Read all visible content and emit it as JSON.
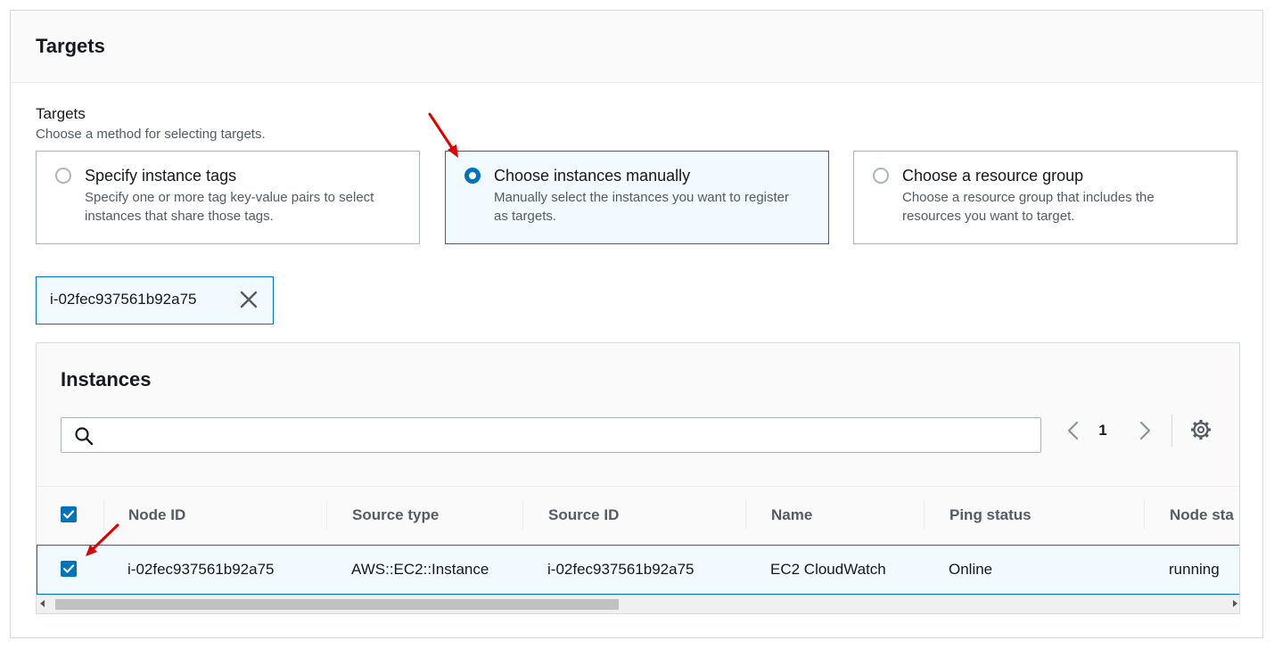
{
  "panel": {
    "title": "Targets"
  },
  "targets_field": {
    "label": "Targets",
    "description": "Choose a method for selecting targets.",
    "options": [
      {
        "title": "Specify instance tags",
        "description": "Specify one or more tag key-value pairs to select instances that share those tags.",
        "selected": false
      },
      {
        "title": "Choose instances manually",
        "description": "Manually select the instances you want to register as targets.",
        "selected": true
      },
      {
        "title": "Choose a resource group",
        "description": "Choose a resource group that includes the resources you want to target.",
        "selected": false
      }
    ]
  },
  "token": {
    "label": "i-02fec937561b92a75",
    "icon": "close-icon"
  },
  "instances": {
    "title": "Instances",
    "search": {
      "value": "",
      "placeholder": ""
    },
    "pagination": {
      "current_page": "1"
    },
    "columns": [
      "Node ID",
      "Source type",
      "Source ID",
      "Name",
      "Ping status",
      "Node sta"
    ],
    "rows": [
      {
        "selected": true,
        "node_id": "i-02fec937561b92a75",
        "source_type": "AWS::EC2::Instance",
        "source_id": "i-02fec937561b92a75",
        "name": "EC2 CloudWatch",
        "ping_status": "Online",
        "node_state": "running"
      }
    ],
    "select_all_checked": true
  },
  "colors": {
    "accent": "#0073bb",
    "selected_bg": "#f1faff",
    "annotation_arrow": "#e00000"
  }
}
